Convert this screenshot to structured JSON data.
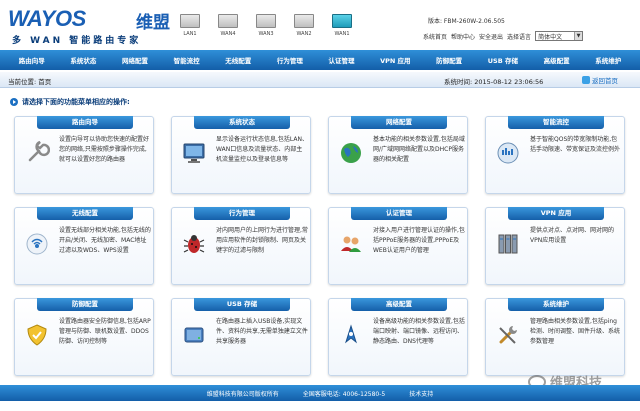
{
  "header": {
    "logo_text": "WAYOS",
    "logo_cn": "维盟",
    "logo_sub": "多 WAN 智能路由专家",
    "version": "版本: FBM-260W-2.06.505",
    "links": [
      "系统首页",
      "帮助中心",
      "安全退出",
      "选择语言"
    ],
    "language": "简体中文",
    "ports": [
      {
        "label": "LAN1",
        "active": false
      },
      {
        "label": "WAN4",
        "active": false
      },
      {
        "label": "WAN3",
        "active": false
      },
      {
        "label": "WAN2",
        "active": false
      },
      {
        "label": "WAN1",
        "active": true
      }
    ]
  },
  "nav": [
    "路由向导",
    "系统状态",
    "网络配置",
    "智能流控",
    "无线配置",
    "行为管理",
    "认证管理",
    "VPN 应用",
    "防御配置",
    "USB 存储",
    "高级配置",
    "系统维护"
  ],
  "location": {
    "label": "当前位置: 首页",
    "time": "系统时间: 2015-08-12 23:06:56",
    "home": "返回首页"
  },
  "intro": "请选择下面的功能菜单相应的操作:",
  "cards": [
    {
      "title": "路由向导",
      "icon": "wrench-icon",
      "desc": "设置向导可以协助您快速的配置好您的网络,只需按照步骤操作完成,就可以设置好您的路由器"
    },
    {
      "title": "系统状态",
      "icon": "monitor-icon",
      "desc": "显示设备运行状态信息,包括LAN、WAN口信息及流量状态、内部主机流量监控以及登录信息等"
    },
    {
      "title": "网络配置",
      "icon": "globe-icon",
      "desc": "基本功能的相关参数设置,包括局域网/广域网网络配置以及DHCP服务器的相关配置"
    },
    {
      "title": "智能流控",
      "icon": "flow-icon",
      "desc": "基于智能QOS的带宽限制功能,包括手动限速、带宽保证及流控例外"
    },
    {
      "title": "无线配置",
      "icon": "wifi-icon",
      "desc": "设置无线部分相关功能,包括无线的开启/关闭、无线加密、MAC地址过滤以及WDS、WPS设置"
    },
    {
      "title": "行为管理",
      "icon": "bug-icon",
      "desc": "对内网用户的上网行为进行管理,常用应用软件的封锁限制、网页及关键字的过滤与限制"
    },
    {
      "title": "认证管理",
      "icon": "users-icon",
      "desc": "对接入用户进行管理认证的操作,包括PPPoE服务器的设置,PPPoE及WEB认证用户的管理"
    },
    {
      "title": "VPN 应用",
      "icon": "server-icon",
      "desc": "提供点对点、点对网、网对网的VPN应用设置"
    },
    {
      "title": "防御配置",
      "icon": "shield-icon",
      "desc": "设置路由器安全防御信息,包括ARP管理与防御、联机数设置、DDOS防御、访问控制等"
    },
    {
      "title": "USB 存储",
      "icon": "usb-drive-icon",
      "desc": "在路由器上插入USB设备,实现文件、资料的共享,无需单独建立文件共享服务器"
    },
    {
      "title": "高级配置",
      "icon": "compass-icon",
      "desc": "设备高级功能的相关参数设置,包括端口映射、端口镜像、远程访问、静态路由、DNS代理等"
    },
    {
      "title": "系统维护",
      "icon": "tools-icon",
      "desc": "管理路由相关参数设置,包括ping检测、时间调整、固件升级、系统参数管理"
    }
  ],
  "footer": [
    "维盟科技有限公司版权所有",
    "全国客服电话: 4006-12580-5",
    "技术支持"
  ],
  "watermark": "维盟科技",
  "colors": {
    "nav": "#1b6fc2",
    "accent": "#155fa9"
  }
}
